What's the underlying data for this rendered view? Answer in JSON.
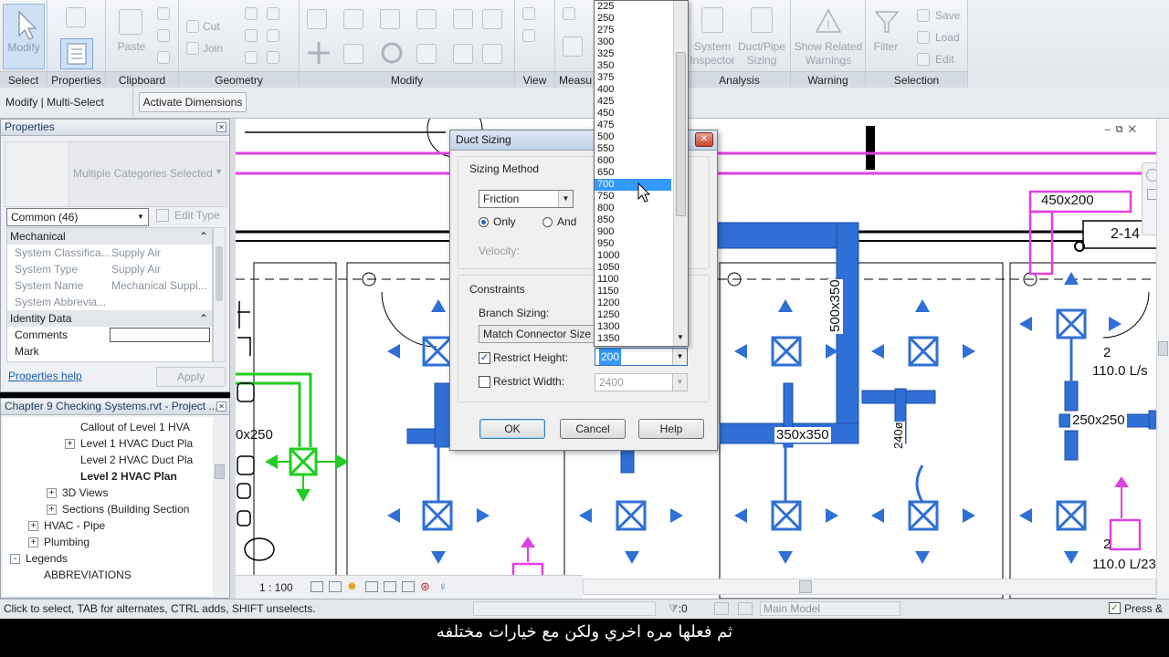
{
  "ribbon": {
    "select": {
      "btn": "Modify",
      "label": "Select"
    },
    "properties": {
      "label": "Properties"
    },
    "clipboard": {
      "paste": "Paste",
      "label": "Clipboard"
    },
    "geometry": {
      "cut": "Cut",
      "join": "Join",
      "label": "Geometry"
    },
    "modify": {
      "label": "Modify"
    },
    "view": {
      "label": "View"
    },
    "measure": {
      "label": "Measu"
    },
    "analysis": {
      "system_inspector": "System\nInspector",
      "duct_pipe_sizing": "Duct/Pipe\nSizing",
      "label": "Analysis"
    },
    "warning": {
      "show_related": "Show Related\nWarnings",
      "label": "Warning"
    },
    "selection": {
      "filter": "Filter",
      "save": "Save",
      "load": "Load",
      "edit": "Edit",
      "label": "Selection"
    }
  },
  "context_bar": {
    "mode": "Modify | Multi-Select",
    "activate_dimensions": "Activate Dimensions"
  },
  "properties_panel": {
    "title": "Properties",
    "type_selector": "Multiple Categories Selected",
    "filter": "Common (46)",
    "edit_type": "Edit Type",
    "groups": [
      {
        "name": "Mechanical",
        "rows": [
          {
            "key": "System Classifica...",
            "value": "Supply Air"
          },
          {
            "key": "System Type",
            "value": "Supply Air"
          },
          {
            "key": "System Name",
            "value": "Mechanical Suppl..."
          },
          {
            "key": "System Abbrevia...",
            "value": ""
          }
        ]
      },
      {
        "name": "Identity Data",
        "rows": [
          {
            "key": "Comments",
            "value": ""
          },
          {
            "key": "Mark",
            "value": ""
          }
        ]
      }
    ],
    "help_link": "Properties help",
    "apply": "Apply"
  },
  "project_browser": {
    "title": "Chapter 9 Checking Systems.rvt - Project ...",
    "items": [
      {
        "label": "Callout of Level 1 HVA",
        "indent": 3,
        "expander": ""
      },
      {
        "label": "Level 1 HVAC Duct Pla",
        "indent": 3,
        "expander": "+"
      },
      {
        "label": "Level 2 HVAC Duct Pla",
        "indent": 3,
        "expander": ""
      },
      {
        "label": "Level 2 HVAC Plan",
        "indent": 3,
        "expander": "",
        "bold": true
      },
      {
        "label": "3D Views",
        "indent": 2,
        "expander": "+"
      },
      {
        "label": "Sections (Building Section",
        "indent": 2,
        "expander": "+"
      },
      {
        "label": "HVAC - Pipe",
        "indent": 1,
        "expander": "+"
      },
      {
        "label": "Plumbing",
        "indent": 1,
        "expander": "+"
      },
      {
        "label": "Legends",
        "indent": 0,
        "expander": "-"
      },
      {
        "label": "ABBREVIATIONS",
        "indent": 1,
        "expander": ""
      }
    ]
  },
  "view_bar": {
    "scale": "1 : 100"
  },
  "drawing_labels": {
    "duct_450x200": "450x200",
    "tag_2_14": "2-14",
    "duct_500x350": "500x350",
    "duct_350x350": "350x350",
    "duct_240": "240ø",
    "duct_250x250": "250x250",
    "duct_x250": "0x250",
    "flow_count_1": "2",
    "flow_1": "110.0 L/s",
    "flow_count_2": "2",
    "flow_2": "110.0 L/23"
  },
  "dialog": {
    "title": "Duct Sizing",
    "sizing_method_label": "Sizing Method",
    "method_value": "Friction",
    "only_label": "Only",
    "and_label": "And",
    "velocity_label": "Velocity:",
    "constraints_label": "Constraints",
    "branch_sizing_label": "Branch Sizing:",
    "branch_sizing_value": "Match Connector Size",
    "restrict_height_label": "Restrict Height:",
    "restrict_height_value": "200",
    "restrict_width_label": "Restrict Width:",
    "restrict_width_value": "2400",
    "ok": "OK",
    "cancel": "Cancel",
    "help": "Help"
  },
  "height_dropdown": {
    "options": [
      "225",
      "250",
      "275",
      "300",
      "325",
      "350",
      "375",
      "400",
      "425",
      "450",
      "475",
      "500",
      "550",
      "600",
      "650",
      "700",
      "750",
      "800",
      "850",
      "900",
      "950",
      "1000",
      "1050",
      "1100",
      "1150",
      "1200",
      "1250",
      "1300",
      "1350"
    ],
    "selected": "700"
  },
  "status_bar": {
    "hint": "Click to select, TAB for alternates, CTRL adds, SHIFT unselects.",
    "selection_count": ":0",
    "model": "Main Model",
    "press": "Press &"
  },
  "subtitle": "ثم فعلها مره اخري ولكن مع خيارات مختلفه",
  "colors": {
    "duct_blue": "#2f6fd6",
    "magenta": "#e040e0",
    "green": "#22cc22",
    "selection_blue": "#3399ff"
  }
}
